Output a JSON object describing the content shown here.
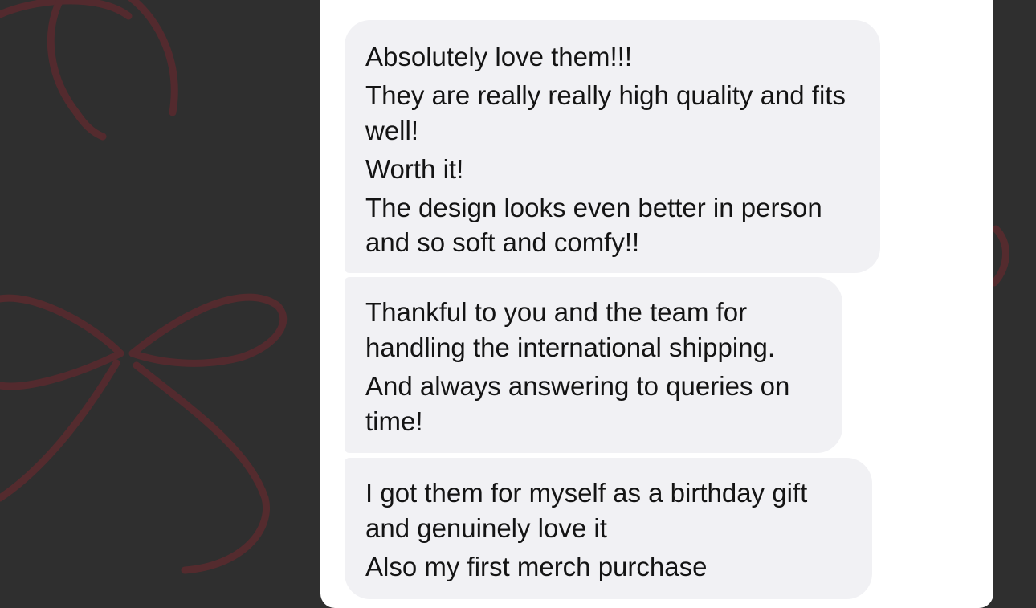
{
  "messages": [
    {
      "lines": [
        "Absolutely love them!!!",
        "They are really really high quality and fits well!",
        "Worth it!",
        "The design looks even better in person and so soft and comfy!!"
      ]
    },
    {
      "lines": [
        "Thankful to you and the team for handling the international shipping.",
        "And always answering to queries on time!"
      ]
    },
    {
      "lines": [
        "I got them for myself as a birthday gift and genuinely love it",
        "Also my first merch purchase"
      ]
    }
  ],
  "colors": {
    "background": "#2f2f2f",
    "ribbon": "#5a2a2e",
    "panel": "#ffffff",
    "bubble": "#f1f1f4",
    "text": "#141414"
  },
  "icons": {
    "background_decoration": "ribbon-bow-icon"
  }
}
